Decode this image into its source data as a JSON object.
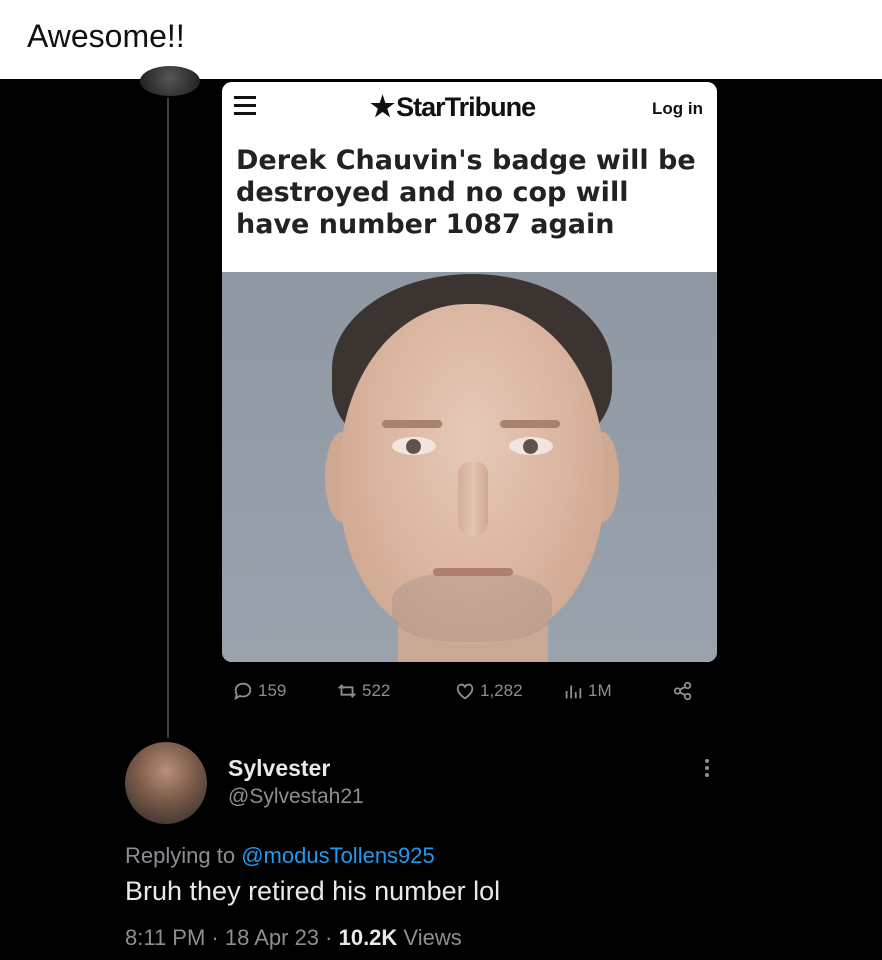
{
  "post": {
    "text": "Awesome!!"
  },
  "quoted_card": {
    "brand": "StarTribune",
    "login_label": "Log in",
    "headline": "Derek Chauvin's badge will be destroyed and no cop will have number 1087 again"
  },
  "actions": {
    "replies": "159",
    "retweets": "522",
    "likes": "1,282",
    "views": "1M"
  },
  "reply_tweet": {
    "name": "Sylvester",
    "handle": "@Sylvestah21",
    "replying_prefix": "Replying to",
    "replying_to": "@modusTollens925",
    "text": "Bruh they retired his number lol",
    "time": "8:11 PM · 18 Apr 23 · ",
    "views_count": "10.2K",
    "views_label": " Views"
  },
  "colors": {
    "background": "#000000",
    "text_primary": "#e7e9ea",
    "text_secondary": "#8b8f94",
    "link": "#1d9bf0"
  },
  "icons": [
    "menu-icon",
    "star-icon",
    "reply-icon",
    "retweet-icon",
    "like-icon",
    "views-icon",
    "share-icon",
    "more-icon"
  ]
}
